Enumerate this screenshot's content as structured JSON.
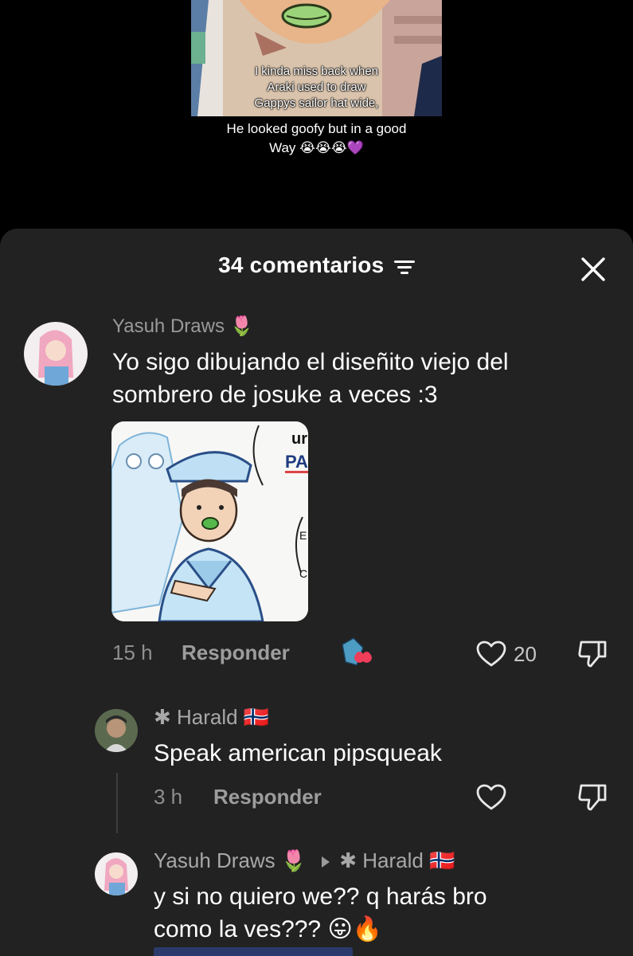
{
  "video": {
    "thumb_caption_lines": [
      "I kinda miss back when",
      "Araki used to draw",
      "Gappys sailor hat wide,"
    ],
    "caption_lines": [
      "He looked goofy but in a good",
      "Way 😭😭😭💜"
    ]
  },
  "sheet": {
    "title": "34 comentarios",
    "filter_icon": "sort-filter-icon",
    "close_icon": "close-icon"
  },
  "comments": [
    {
      "author": "Yasuh Draws 🌷",
      "text": "Yo sigo dibujando el diseñito viejo del sombrero de josuke a veces :3",
      "time": "15 h",
      "reply_label": "Responder",
      "likes": "20",
      "image_text": [
        "ur",
        "PA",
        "E",
        "C"
      ]
    },
    {
      "author": "✱ Harald 🇳🇴",
      "text": "Speak american pipsqueak",
      "time": "3 h",
      "reply_label": "Responder"
    },
    {
      "author": "Yasuh Draws 🌷",
      "reply_to": "✱ Harald 🇳🇴",
      "text_line1": "y si no quiero we?? q harás bro",
      "text_line2": "como la ves??? 😛🔥"
    }
  ],
  "colors": {
    "sheet_bg": "#222222",
    "secondary_text": "#9a9a9a",
    "like_heart": "#e8e8e8"
  }
}
